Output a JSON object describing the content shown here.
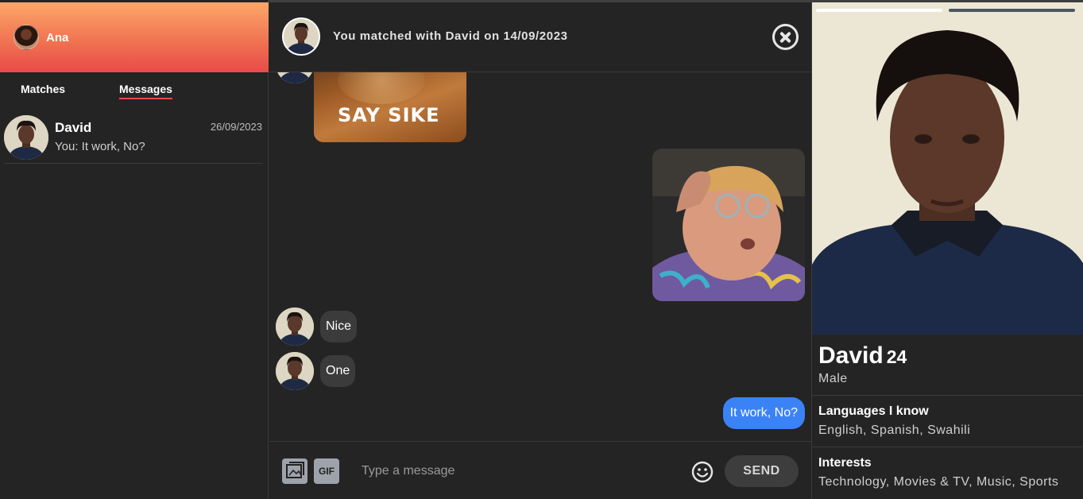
{
  "sidebar": {
    "user_name": "Ana",
    "tabs": [
      {
        "label": "Matches"
      },
      {
        "label": "Messages"
      }
    ],
    "conversations": [
      {
        "name": "David",
        "date": "26/09/2023",
        "preview": "You: It work, No?"
      }
    ]
  },
  "chat": {
    "match_text": "You matched with David on 14/09/2023",
    "gif_caption": "SAY SIKE",
    "messages": [
      {
        "from": "them",
        "text": "Nice"
      },
      {
        "from": "them",
        "text": "One"
      },
      {
        "from": "me",
        "text": "It work, No?"
      }
    ],
    "composer": {
      "gif_label": "GIF",
      "placeholder": "Type a message",
      "send_label": "SEND"
    }
  },
  "profile": {
    "name": "David",
    "age": "24",
    "gender": "Male",
    "photo_count": 2,
    "current_photo": 1,
    "sections": [
      {
        "title": "Languages I know",
        "value": "English, Spanish, Swahili"
      },
      {
        "title": "Interests",
        "value": "Technology, Movies & TV, Music, Sports"
      }
    ]
  },
  "colors": {
    "header_gradient_top": "#fda76b",
    "header_gradient_bottom": "#e94a4a",
    "outgoing_bubble": "#3b82f6",
    "incoming_bubble": "#3b3b3b",
    "background": "#242424"
  },
  "icons": [
    "close-icon",
    "image-icon",
    "gif-icon",
    "emoji-icon"
  ]
}
